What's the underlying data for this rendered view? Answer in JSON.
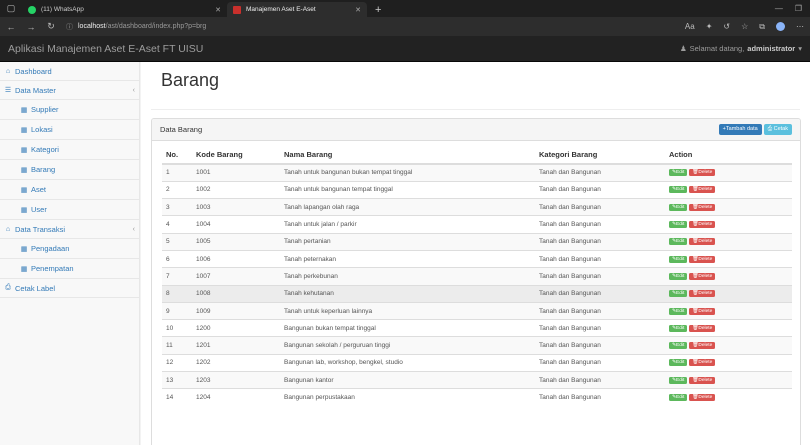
{
  "browser": {
    "tabs": [
      {
        "label": "(11) WhatsApp",
        "icon": "whatsapp-icon"
      },
      {
        "label": "Manajemen Aset E-Aset",
        "icon": "app-icon"
      }
    ],
    "url_host": "localhost",
    "url_path": "/ast/dashboard/index.php?p=brg"
  },
  "app": {
    "brand": "Aplikasi Manajemen Aset E-Aset FT UISU",
    "welcome_prefix": "Selamat datang,",
    "welcome_user": "administrator"
  },
  "sidebar": {
    "dashboard": "Dashboard",
    "data_master": "Data Master",
    "supplier": "Supplier",
    "lokasi": "Lokasi",
    "kategori": "Kategori",
    "barang": "Barang",
    "aset": "Aset",
    "user": "User",
    "data_transaksi": "Data Transaksi",
    "pengadaan": "Pengadaan",
    "penempatan": "Penempatan",
    "cetak_label": "Cetak Label"
  },
  "main": {
    "title": "Barang",
    "panel_title": "Data Barang",
    "add_label": "+Tambah data",
    "print_label": "Cetak",
    "columns": {
      "no": "No.",
      "kode": "Kode Barang",
      "nama": "Nama Barang",
      "kategori": "Kategori Barang",
      "action": "Action"
    },
    "edit_label": "Edit",
    "delete_label": "Delete",
    "rows": [
      {
        "no": "1",
        "kode": "1001",
        "nama": "Tanah untuk bangunan bukan tempat tinggal",
        "kategori": "Tanah dan Bangunan"
      },
      {
        "no": "2",
        "kode": "1002",
        "nama": "Tanah untuk bangunan tempat tinggal",
        "kategori": "Tanah dan Bangunan"
      },
      {
        "no": "3",
        "kode": "1003",
        "nama": "Tanah lapangan olah raga",
        "kategori": "Tanah dan Bangunan"
      },
      {
        "no": "4",
        "kode": "1004",
        "nama": "Tanah untuk jalan / parkir",
        "kategori": "Tanah dan Bangunan"
      },
      {
        "no": "5",
        "kode": "1005",
        "nama": "Tanah pertanian",
        "kategori": "Tanah dan Bangunan"
      },
      {
        "no": "6",
        "kode": "1006",
        "nama": "Tanah peternakan",
        "kategori": "Tanah dan Bangunan"
      },
      {
        "no": "7",
        "kode": "1007",
        "nama": "Tanah perkebunan",
        "kategori": "Tanah dan Bangunan"
      },
      {
        "no": "8",
        "kode": "1008",
        "nama": "Tanah kehutanan",
        "kategori": "Tanah dan Bangunan"
      },
      {
        "no": "9",
        "kode": "1009",
        "nama": "Tanah untuk keperluan lainnya",
        "kategori": "Tanah dan Bangunan"
      },
      {
        "no": "10",
        "kode": "1200",
        "nama": "Bangunan bukan tempat tinggal",
        "kategori": "Tanah dan Bangunan"
      },
      {
        "no": "11",
        "kode": "1201",
        "nama": "Bangunan sekolah / perguruan tinggi",
        "kategori": "Tanah dan Bangunan"
      },
      {
        "no": "12",
        "kode": "1202",
        "nama": "Bangunan lab, workshop, bengkel, studio",
        "kategori": "Tanah dan Bangunan"
      },
      {
        "no": "13",
        "kode": "1203",
        "nama": "Bangunan kantor",
        "kategori": "Tanah dan Bangunan"
      },
      {
        "no": "14",
        "kode": "1204",
        "nama": "Bangunan perpustakaan",
        "kategori": "Tanah dan Bangunan"
      }
    ]
  },
  "colors": {
    "primary": "#337ab7",
    "success": "#5cb85c",
    "danger": "#d9534f",
    "navbar": "#222222"
  }
}
